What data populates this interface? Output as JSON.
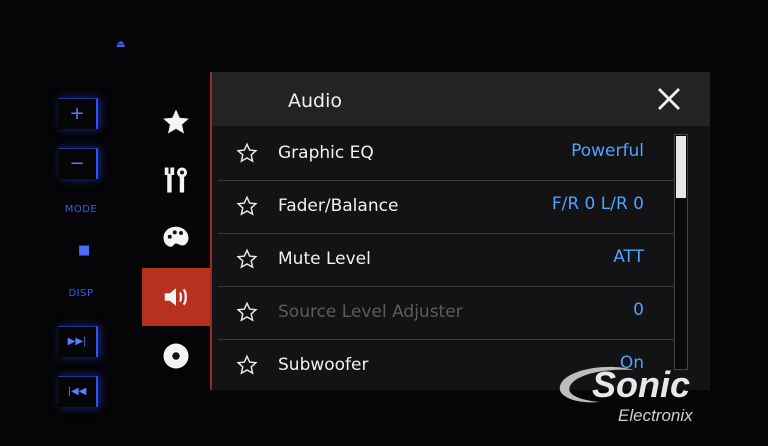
{
  "hardware": {
    "plus_label": "+",
    "minus_label": "−",
    "mode_label": "MODE",
    "disp_label": "DISP",
    "menu_glyph": "■",
    "next_glyph": "▶▶|",
    "prev_glyph": "|◀◀",
    "eject_glyph": "⏏"
  },
  "sidebar": {
    "items": [
      {
        "name": "favorites",
        "icon": "star-icon"
      },
      {
        "name": "system",
        "icon": "tools-icon"
      },
      {
        "name": "theme",
        "icon": "palette-icon"
      },
      {
        "name": "audio",
        "icon": "speaker-icon",
        "active": true
      },
      {
        "name": "video",
        "icon": "disc-icon"
      }
    ]
  },
  "header": {
    "title": "Audio",
    "close_icon": "close-icon"
  },
  "list": {
    "rows": [
      {
        "label": "Graphic EQ",
        "value": "Powerful",
        "enabled": true
      },
      {
        "label": "Fader/Balance",
        "value": "F/R 0 L/R 0",
        "enabled": true
      },
      {
        "label": "Mute Level",
        "value": "ATT",
        "enabled": true
      },
      {
        "label": "Source Level Adjuster",
        "value": "0",
        "enabled": false
      },
      {
        "label": "Subwoofer",
        "value": "On",
        "enabled": true
      }
    ]
  },
  "watermark": {
    "brand": "Sonic",
    "sub": "Electronix"
  },
  "colors": {
    "accent": "#b8311f",
    "value_blue": "#4ea3ff",
    "hardware_blue": "#3050ff"
  }
}
